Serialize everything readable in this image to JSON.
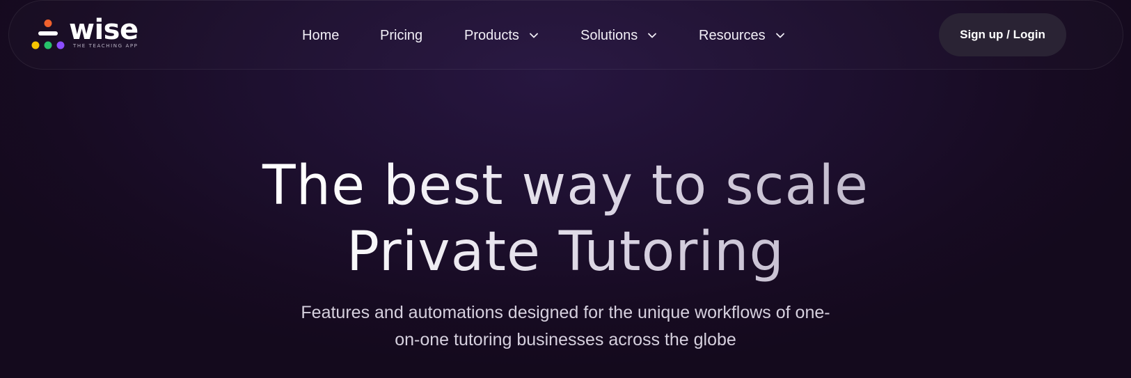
{
  "brand": {
    "name": "wise",
    "tagline": "THE TEACHING APP",
    "colors": {
      "top_dot": "#f0612d",
      "bar": "#f0612d",
      "dot_yellow": "#f6c400",
      "dot_green": "#27c26a",
      "dot_purple": "#8b4dff"
    }
  },
  "nav": {
    "items": [
      {
        "label": "Home",
        "has_dropdown": false
      },
      {
        "label": "Pricing",
        "has_dropdown": false
      },
      {
        "label": "Products",
        "has_dropdown": true,
        "icon": "chevron-down-icon"
      },
      {
        "label": "Solutions",
        "has_dropdown": true,
        "icon": "chevron-down-icon"
      },
      {
        "label": "Resources",
        "has_dropdown": true,
        "icon": "chevron-down-icon"
      }
    ],
    "cta_label": "Sign up / Login"
  },
  "hero": {
    "title_line1": "The best way to scale",
    "title_line2": "Private Tutoring",
    "subtitle_line1": "Features and automations designed for the unique workflows of one-",
    "subtitle_line2": "on-one tutoring businesses across the globe"
  }
}
